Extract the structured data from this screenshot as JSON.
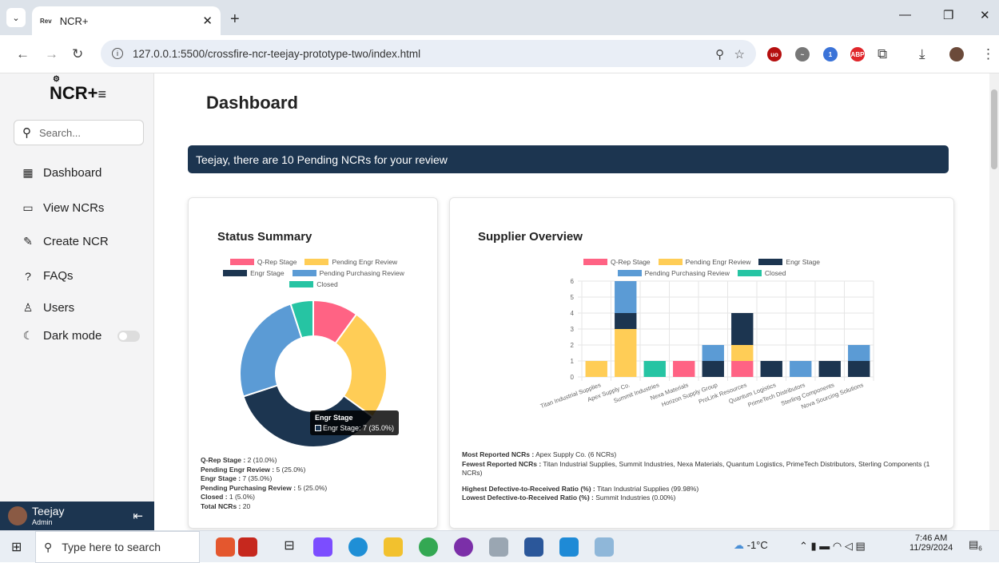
{
  "browser": {
    "tab_title": "NCR+",
    "tab_favicon_text": "Rev",
    "url": "127.0.0.1:5500/crossfire-ncr-teejay-prototype-two/index.html"
  },
  "sidebar": {
    "logo_text": "NCR+",
    "logo_menu_symbol": "≡",
    "search_placeholder": "Search...",
    "items": [
      {
        "label": "Dashboard",
        "icon": "grid-icon"
      },
      {
        "label": "View NCRs",
        "icon": "folder-icon"
      },
      {
        "label": "Create NCR",
        "icon": "edit-icon"
      },
      {
        "label": "FAQs",
        "icon": "question-icon"
      },
      {
        "label": "Users",
        "icon": "user-icon"
      },
      {
        "label": "Dark mode",
        "icon": "moon-icon"
      }
    ],
    "user": {
      "name": "Teejay",
      "role": "Admin"
    }
  },
  "main": {
    "title": "Dashboard",
    "banner": "Teejay, there are 10 Pending NCRs for your review"
  },
  "colors": {
    "qrep": "#ff6384",
    "pending_engr": "#ffcd56",
    "engr": "#1c3550",
    "pending_purchasing": "#5b9bd5",
    "closed": "#26c4a3",
    "navy": "#1c3550"
  },
  "status_summary": {
    "title": "Status Summary",
    "tooltip_title": "Engr Stage",
    "tooltip_body": "Engr Stage: 7 (35.0%)",
    "stats": [
      {
        "label": "Q-Rep Stage :",
        "value": " 2 (10.0%)"
      },
      {
        "label": "Pending Engr Review :",
        "value": " 5 (25.0%)"
      },
      {
        "label": "Engr Stage :",
        "value": " 7 (35.0%)"
      },
      {
        "label": "Pending Purchasing Review :",
        "value": " 5 (25.0%)"
      },
      {
        "label": "Closed :",
        "value": " 1 (5.0%)"
      },
      {
        "label": "Total NCRs :",
        "value": " 20"
      }
    ]
  },
  "supplier_overview": {
    "title": "Supplier Overview",
    "stats": [
      {
        "label": "Most Reported NCRs :",
        "value": " Apex Supply Co. (6 NCRs)"
      },
      {
        "label": "Fewest Reported NCRs :",
        "value": " Titan Industrial Supplies, Summit Industries, Nexa Materials, Quantum Logistics, PrimeTech Distributors, Sterling Components (1 NCRs)"
      },
      {
        "label": "Highest Defective-to-Received Ratio (%) :",
        "value": " Titan Industrial Supplies (99.98%)"
      },
      {
        "label": "Lowest Defective-to-Received Ratio (%) :",
        "value": " Summit Industries (0.00%)"
      }
    ]
  },
  "chart_data": [
    {
      "type": "pie",
      "title": "Status Summary",
      "categories": [
        "Q-Rep Stage",
        "Pending Engr Review",
        "Engr Stage",
        "Pending Purchasing Review",
        "Closed"
      ],
      "values": [
        2,
        5,
        7,
        5,
        1
      ],
      "colors": [
        "#ff6384",
        "#ffcd56",
        "#1c3550",
        "#5b9bd5",
        "#26c4a3"
      ],
      "legend": "top"
    },
    {
      "type": "bar",
      "stacked": true,
      "title": "Supplier Overview",
      "categories": [
        "Titan Industrial Supplies",
        "Apex Supply Co.",
        "Summit Industries",
        "Nexa Materials",
        "Horizon Supply Group",
        "ProLink Resources",
        "Quantum Logistics",
        "PrimeTech Distributors",
        "Sterling Components",
        "Nova Sourcing Solutions"
      ],
      "series": [
        {
          "name": "Q-Rep Stage",
          "color": "#ff6384",
          "values": [
            0,
            0,
            0,
            1,
            0,
            1,
            0,
            0,
            0,
            0
          ]
        },
        {
          "name": "Pending Engr Review",
          "color": "#ffcd56",
          "values": [
            1,
            3,
            0,
            0,
            0,
            1,
            0,
            0,
            0,
            0
          ]
        },
        {
          "name": "Engr Stage",
          "color": "#1c3550",
          "values": [
            0,
            1,
            0,
            0,
            1,
            2,
            1,
            0,
            1,
            1
          ]
        },
        {
          "name": "Pending Purchasing Review",
          "color": "#5b9bd5",
          "values": [
            0,
            2,
            0,
            0,
            1,
            0,
            0,
            1,
            0,
            1
          ]
        },
        {
          "name": "Closed",
          "color": "#26c4a3",
          "values": [
            0,
            0,
            1,
            0,
            0,
            0,
            0,
            0,
            0,
            0
          ]
        }
      ],
      "ylim": [
        0,
        6
      ],
      "yticks": [
        0,
        1,
        2,
        3,
        4,
        5,
        6
      ],
      "grid": true,
      "legend": "top"
    }
  ],
  "taskbar": {
    "search_placeholder": "Type here to search",
    "weather": "-1°C",
    "time": "7:46 AM",
    "date": "11/29/2024",
    "notification_count": "6"
  }
}
